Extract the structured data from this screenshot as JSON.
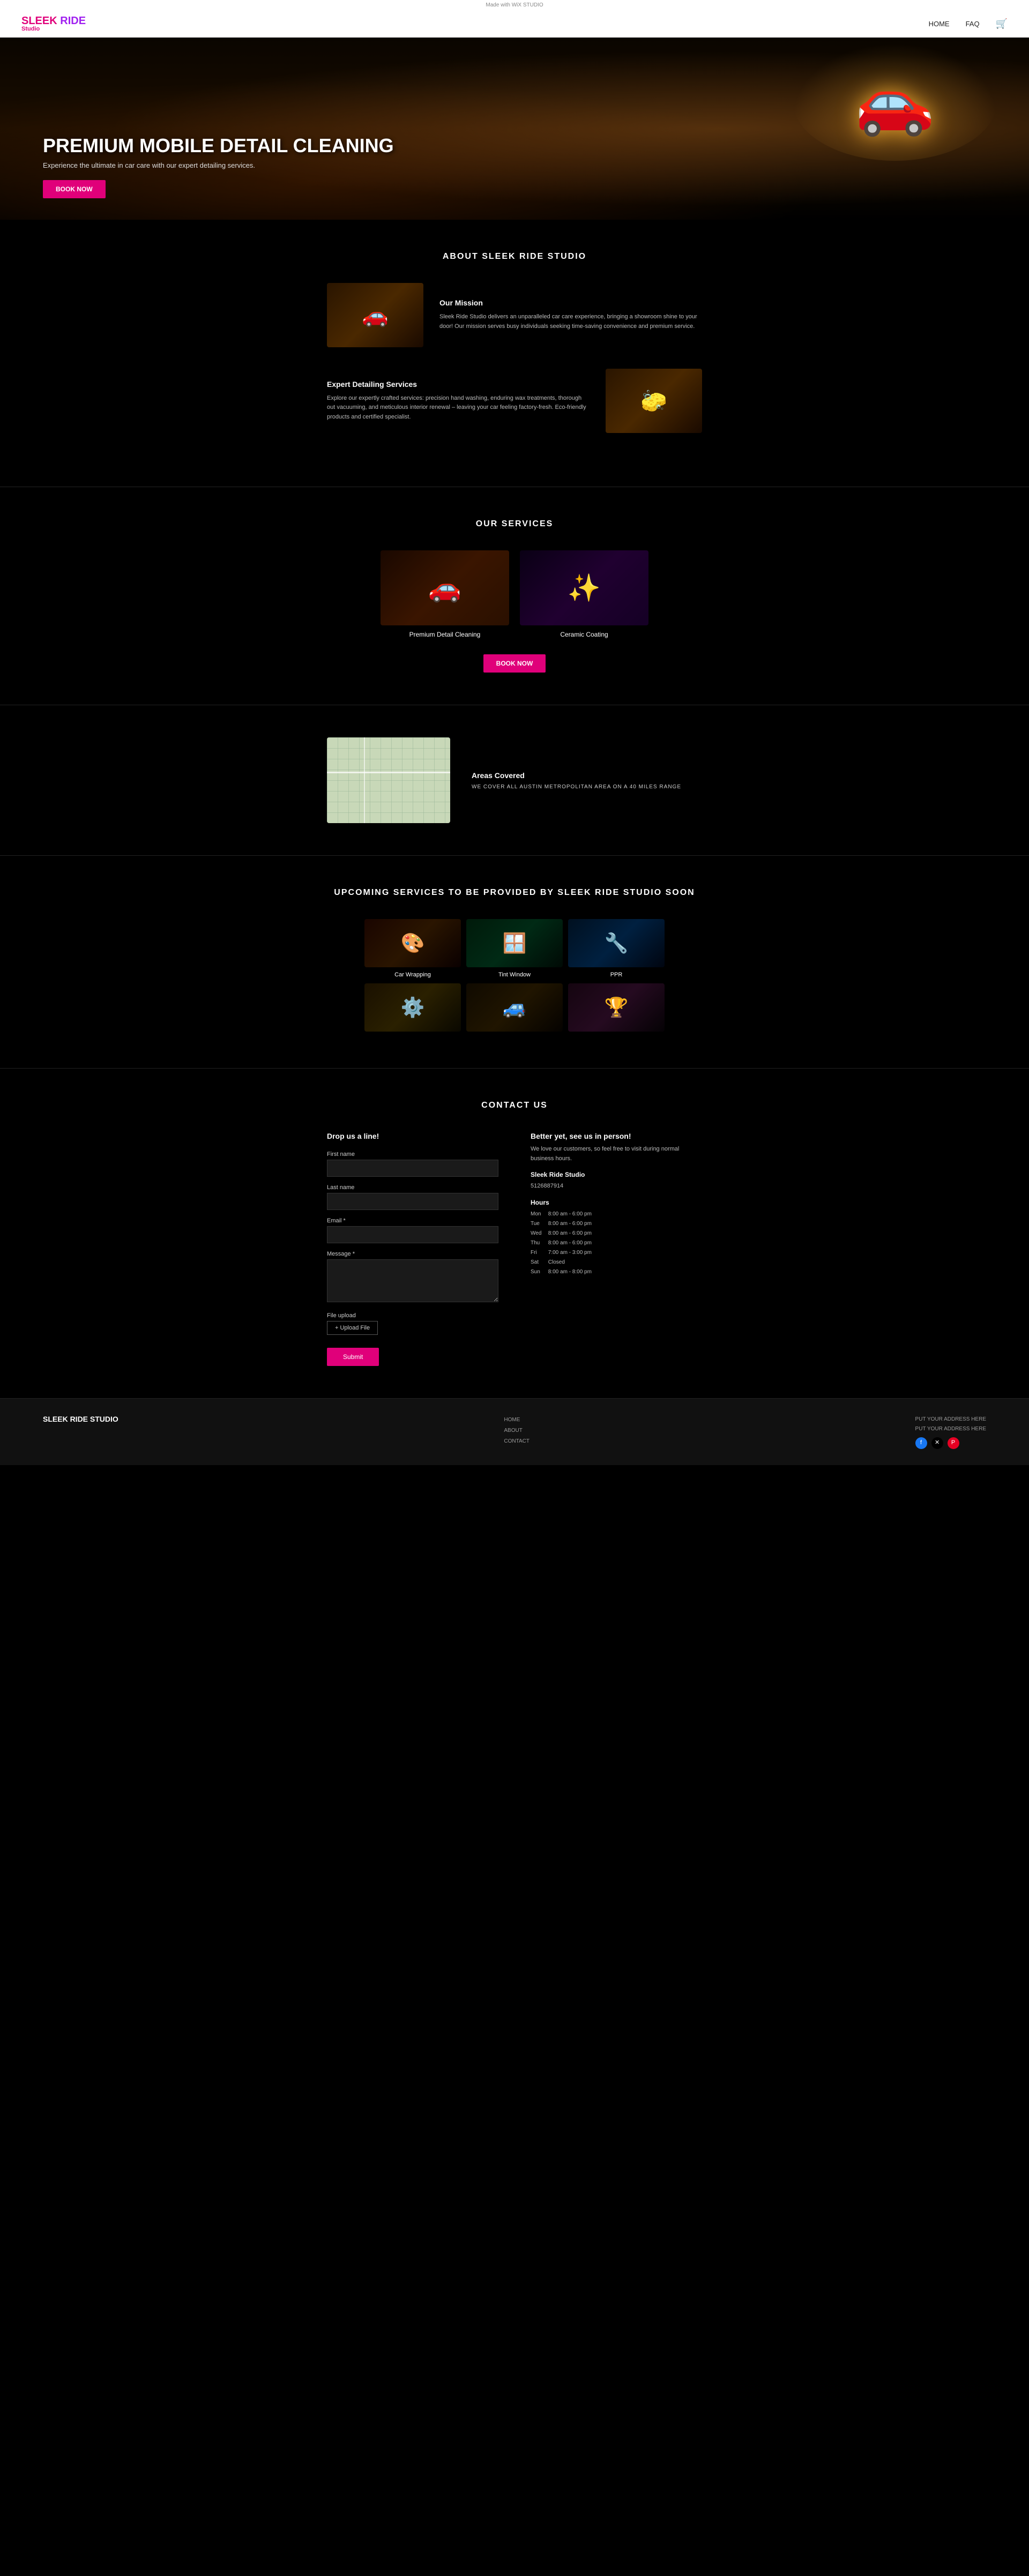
{
  "topbar": {
    "text": "Made with WiX STUDIO"
  },
  "nav": {
    "logo_sleek": "SLEEK",
    "logo_ride": " RIDE",
    "logo_studio": "Studio",
    "links": [
      {
        "label": "HOME",
        "href": "#"
      },
      {
        "label": "FAQ",
        "href": "#"
      }
    ],
    "cart_icon": "🛒"
  },
  "hero": {
    "title": "PREMIUM MOBILE DETAIL CLEANING",
    "subtitle": "Experience the ultimate in car care with our expert detailing services.",
    "cta": "BOOK NOW"
  },
  "about": {
    "section_title": "ABOUT SLEEK RIDE STUDIO",
    "mission_title": "Our Mission",
    "mission_text": "Sleek Ride Studio delivers an unparalleled car care experience, bringing a showroom shine to your door! Our mission serves busy individuals seeking time-saving convenience and premium service.",
    "services_title": "Expert Detailing Services",
    "services_text": "Explore our expertly crafted services: precision hand washing, enduring wax treatments, thorough out vacuuming, and meticulous interior renewal – leaving your car feeling factory-fresh. Eco-friendly products and certified specialist."
  },
  "services": {
    "section_title": "OUR SERVICES",
    "items": [
      {
        "label": "Premium Detail Cleaning",
        "icon": "🚗"
      },
      {
        "label": "Ceramic Coating",
        "icon": "✨"
      }
    ],
    "cta": "BOOK NOW"
  },
  "map": {
    "section_title": "Areas Covered",
    "description": "WE COVER ALL AUSTIN METROPOLITAN AREA on a 40 miles range"
  },
  "upcoming": {
    "section_title": "UPCOMING SERVICES TO BE PROVIDED BY SLEEK RIDE STUDIO SOON",
    "items": [
      {
        "label": "Car Wrapping",
        "icon": "🎨"
      },
      {
        "label": "Tint Window",
        "icon": "🪟"
      },
      {
        "label": "PPR",
        "icon": "🔧"
      },
      {
        "label": "",
        "icon": "⚙️"
      },
      {
        "label": "",
        "icon": "🚙"
      },
      {
        "label": "",
        "icon": "🏆"
      }
    ]
  },
  "contact": {
    "section_title": "CONTACT US",
    "form_title": "Drop us a line!",
    "fields": {
      "first_name": "First name",
      "last_name": "Last name",
      "email": "Email *",
      "message": "Message *",
      "file_upload": "File upload",
      "upload_btn": "+ Upload File",
      "submit_btn": "Submit"
    },
    "info_title": "Better yet, see us in person!",
    "info_text": "We love our customers, so feel free to visit during normal business hours.",
    "business_name": "Sleek Ride Studio",
    "phone": "5126887914",
    "hours_title": "Hours",
    "hours": [
      {
        "day": "Mon",
        "time": "8:00 am - 6:00 pm"
      },
      {
        "day": "Tue",
        "time": "8:00 am - 6:00 pm"
      },
      {
        "day": "Wed",
        "time": "8:00 am - 6:00 pm"
      },
      {
        "day": "Thu",
        "time": "8:00 am - 6:00 pm"
      },
      {
        "day": "Fri",
        "time": "7:00 am - 3:00 pm"
      },
      {
        "day": "Sat",
        "time": "Closed"
      },
      {
        "day": "Sun",
        "time": "8:00 am - 8:00 pm"
      }
    ]
  },
  "footer": {
    "logo": "SLEEK RIDE STUDIO",
    "links": [
      {
        "label": "HOME"
      },
      {
        "label": "ABOUT"
      },
      {
        "label": "CONTACT"
      }
    ],
    "address_title": "PUT YOUR ADDRESS HERE",
    "address_line": "PUT YOUR ADDRESS HERE",
    "socials": [
      {
        "name": "facebook",
        "class": "fb",
        "icon": "f"
      },
      {
        "name": "twitter",
        "class": "tw",
        "icon": "✕"
      },
      {
        "name": "pinterest",
        "class": "pi",
        "icon": "P"
      }
    ]
  },
  "colors": {
    "accent": "#e0007a",
    "purple": "#a020f0",
    "dark_bg": "#000000",
    "nav_bg": "#ffffff"
  }
}
